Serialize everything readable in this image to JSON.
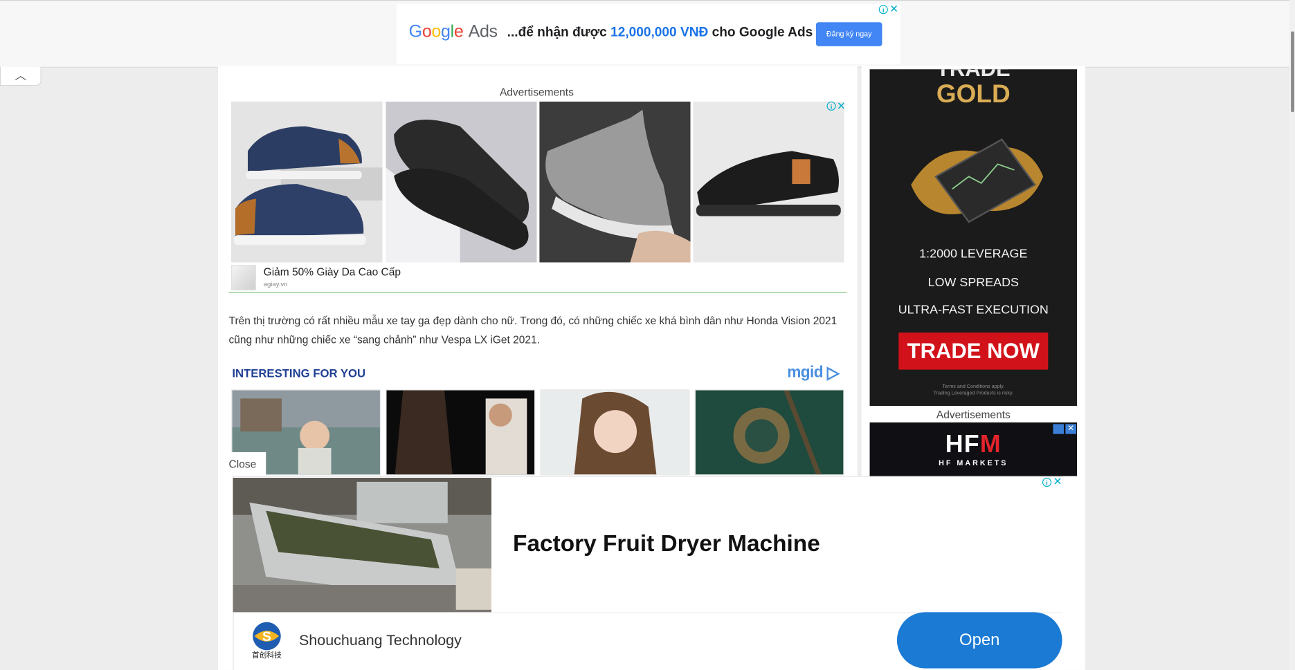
{
  "top_ad": {
    "logo_google": [
      "G",
      "o",
      "o",
      "g",
      "l",
      "e"
    ],
    "logo_ads": "Ads",
    "text_prefix": "...để nhận được ",
    "amount": "12,000,000 VNĐ",
    "text_suffix": " cho Google Ads",
    "button_label": "Đăng ký ngay",
    "info_glyph": "i",
    "close_glyph": "✕"
  },
  "collapse_glyph": "︿",
  "content": {
    "advertisements_label": "Advertisements",
    "shoe_ad": {
      "title": "Giảm 50% Giày Da Cao Cấp",
      "domain": "agiay.vn",
      "images": [
        "navy-leather-sneakers",
        "black-leather-loafer",
        "grey-knit-sneaker",
        "black-leather-sandal"
      ]
    },
    "paragraph": "Trên thị trường có rất nhiều mẫu xe tay ga đẹp dành cho nữ. Trong đó, có những chiếc xe khá bình dân như Honda Vision 2021 cũng như những chiếc xe “sang chảnh” như Vespa LX iGet 2021.",
    "interesting": {
      "title": "INTERESTING FOR YOU",
      "brand": "mgid",
      "cards": [
        "woman-riverside",
        "couple-night",
        "woman-portrait",
        "snake-water"
      ]
    },
    "close_label": "Close"
  },
  "sidebar": {
    "trade_ad": {
      "headline_cut": "TRADE",
      "headline": "GOLD",
      "line1": "1:2000 LEVERAGE",
      "line2": "LOW SPREADS",
      "line3": "ULTRA-FAST EXECUTION",
      "button": "TRADE NOW",
      "terms1": "Terms and Conditions apply.",
      "terms2": "Trading Leveraged Products is risky."
    },
    "advertisements_label": "Advertisements",
    "hfm_ad": {
      "logo_hf": "HF",
      "logo_m": "M",
      "subtitle": "HF MARKETS"
    }
  },
  "bottom_ad": {
    "title": "Factory Fruit Dryer Machine",
    "brand": "Shouchuang Technology",
    "logo_caption": "首创科技",
    "button": "Open"
  },
  "colors": {
    "accent_blue": "#1b7ad4",
    "trade_red": "#d2121a",
    "gold": "#d9ac55",
    "heading_navy": "#1f3f94"
  }
}
